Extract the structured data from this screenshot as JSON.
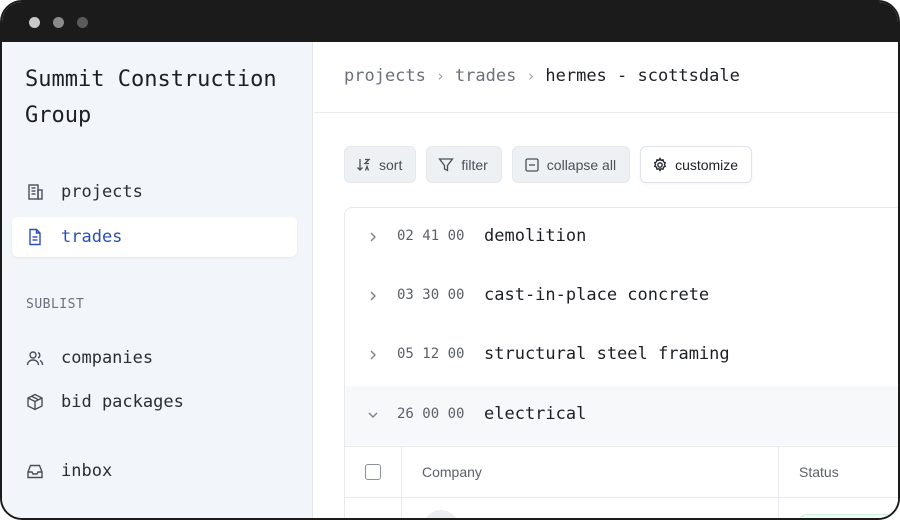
{
  "app": {
    "company_name": "Summit Construction Group"
  },
  "sidebar": {
    "items": [
      {
        "label": "projects",
        "icon": "building-icon"
      },
      {
        "label": "trades",
        "icon": "document-icon",
        "active": true
      }
    ],
    "sublist_label": "SUBLIST",
    "sublist": [
      {
        "label": "companies",
        "icon": "users-icon"
      },
      {
        "label": "bid packages",
        "icon": "package-icon"
      }
    ],
    "bottom": [
      {
        "label": "inbox",
        "icon": "inbox-icon"
      }
    ]
  },
  "breadcrumb": {
    "items": [
      "projects",
      "trades"
    ],
    "current": "hermes - scottsdale"
  },
  "toolbar": {
    "sort_label": "sort",
    "filter_label": "filter",
    "collapse_label": "collapse all",
    "customize_label": "customize"
  },
  "trades": [
    {
      "code": "02 41 00",
      "name": "demolition",
      "expanded": false
    },
    {
      "code": "03 30 00",
      "name": "cast-in-place concrete",
      "expanded": false
    },
    {
      "code": "05 12 00",
      "name": "structural steel framing",
      "expanded": false
    },
    {
      "code": "26 00 00",
      "name": "electrical",
      "expanded": true
    }
  ],
  "subtable": {
    "columns": [
      "Company",
      "Status"
    ]
  },
  "colors": {
    "accent": "#2b4fb8",
    "titlebar": "#1b1b1c",
    "sidebar_bg": "#f2f5f9"
  }
}
